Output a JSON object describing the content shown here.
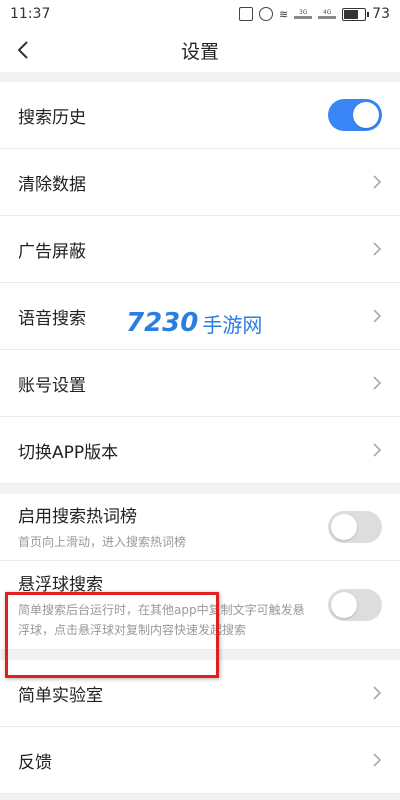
{
  "status_bar": {
    "time": "11:37",
    "net1": "3G",
    "net2": "4G",
    "battery": "73",
    "battery_level": 0.73
  },
  "header": {
    "title": "设置"
  },
  "group1": [
    {
      "label": "搜索历史",
      "control": "toggle",
      "on": true
    },
    {
      "label": "清除数据",
      "control": "chevron"
    },
    {
      "label": "广告屏蔽",
      "control": "chevron"
    },
    {
      "label": "语音搜索",
      "control": "chevron"
    },
    {
      "label": "账号设置",
      "control": "chevron"
    },
    {
      "label": "切换APP版本",
      "control": "chevron"
    }
  ],
  "group2": [
    {
      "label": "启用搜索热词榜",
      "sub": "首页向上滑动，进入搜索热词榜",
      "on": false
    },
    {
      "label": "悬浮球搜索",
      "sub": "简单搜索后台运行时，在其他app中复制文字可触发悬浮球，点击悬浮球对复制内容快速发起搜索",
      "on": false
    }
  ],
  "group3": [
    {
      "label": "简单实验室"
    },
    {
      "label": "反馈"
    }
  ],
  "watermark": {
    "number": "7230",
    "text": "手游网"
  },
  "colors": {
    "accent": "#3b86f6",
    "highlight_box": "#e02020"
  }
}
